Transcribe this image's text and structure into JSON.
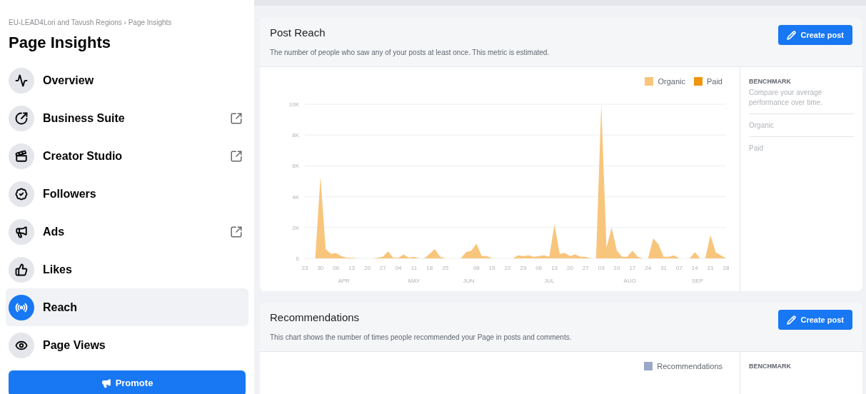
{
  "breadcrumb": "EU-LEAD4Lori and Tavush Regions › Page Insights",
  "title": "Page Insights",
  "sidebar": {
    "items": [
      {
        "label": "Overview",
        "selected": false,
        "external": false
      },
      {
        "label": "Business Suite",
        "selected": false,
        "external": true
      },
      {
        "label": "Creator Studio",
        "selected": false,
        "external": true
      },
      {
        "label": "Followers",
        "selected": false,
        "external": false
      },
      {
        "label": "Ads",
        "selected": false,
        "external": true
      },
      {
        "label": "Likes",
        "selected": false,
        "external": false
      },
      {
        "label": "Reach",
        "selected": true,
        "external": false
      },
      {
        "label": "Page Views",
        "selected": false,
        "external": false
      }
    ],
    "promote_button": "Promote"
  },
  "cards": [
    {
      "title": "Post Reach",
      "description": "The number of people who saw any of your posts at least once. This metric is estimated.",
      "button": "Create post",
      "legend": [
        {
          "name": "Paid",
          "color": "#f0960e"
        }
      ],
      "benchmark": {
        "heading": "BENCHMARK",
        "text": "Compare your average performance over time.",
        "rows": [
          "Organic",
          "Paid"
        ]
      },
      "chart_data": {
        "type": "area",
        "grid": true,
        "categories": [
          "23",
          null,
          null,
          "30",
          null,
          null,
          "06",
          null,
          null,
          "13",
          null,
          null,
          "20",
          null,
          null,
          "27",
          null,
          null,
          "04",
          null,
          null,
          "11",
          null,
          null,
          "18",
          null,
          null,
          "25",
          null,
          null,
          null,
          null,
          null,
          "08",
          null,
          null,
          "15",
          null,
          null,
          "22",
          null,
          null,
          "29",
          null,
          null,
          "06",
          null,
          null,
          "13",
          null,
          null,
          "20",
          null,
          null,
          "27",
          null,
          null,
          "03",
          null,
          null,
          "10",
          null,
          null,
          "17",
          null,
          null,
          "24",
          null,
          null,
          "31",
          null,
          null,
          "07",
          null,
          null,
          "14",
          null,
          null,
          "21",
          null,
          null,
          "28"
        ],
        "series": [
          {
            "name": "Organic",
            "color": "#f8c57c",
            "values": [
              0,
              0,
              0,
              5300,
              600,
              300,
              350,
              150,
              50,
              50,
              0,
              0,
              0,
              0,
              50,
              100,
              450,
              50,
              50,
              250,
              50,
              100,
              0,
              0,
              300,
              600,
              100,
              0,
              0,
              0,
              0,
              400,
              500,
              950,
              150,
              150,
              0,
              0,
              0,
              0,
              0,
              200,
              150,
              200,
              100,
              150,
              200,
              100,
              2200,
              300,
              350,
              150,
              250,
              100,
              100,
              0,
              0,
              10000,
              700,
              2000,
              500,
              100,
              100,
              500,
              100,
              0,
              0,
              1300,
              900,
              100,
              100,
              200,
              0,
              0,
              0,
              400,
              0,
              0,
              1500,
              400,
              200,
              0
            ]
          }
        ],
        "ylim": [
          0,
          10000
        ],
        "yticks": [
          {
            "value": 0,
            "label": "0"
          },
          {
            "value": 2000,
            "label": "2K"
          },
          {
            "value": 4000,
            "label": "4K"
          },
          {
            "value": 6000,
            "label": "6K"
          },
          {
            "value": 8000,
            "label": "8K"
          },
          {
            "value": 10000,
            "label": "10K"
          }
        ]
      },
      "month_labels": [
        "APR",
        "MAY",
        "JUN",
        "JUL",
        "AUG",
        "SEP"
      ]
    },
    {
      "title": "Recommendations",
      "description": "This chart shows the number of times people recommended your Page in posts and comments.",
      "button": "Create post",
      "benchmark": {
        "heading": "BENCHMARK"
      },
      "legend": [
        {
          "name": "Recommendations",
          "color": "#9aa7c7"
        }
      ]
    }
  ]
}
